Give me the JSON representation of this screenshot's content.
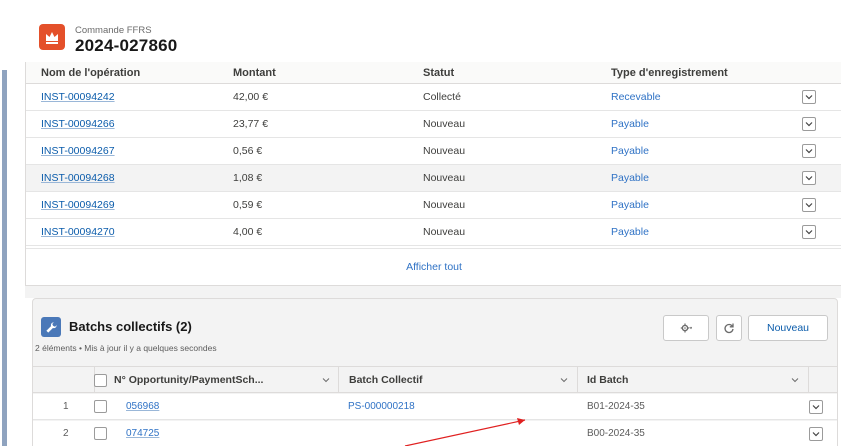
{
  "record": {
    "icon": "crown-icon",
    "object_label": "Commande FFRS",
    "title": "2024-027860"
  },
  "installments": {
    "columns": {
      "name": "Nom de l'opération",
      "amount": "Montant",
      "status": "Statut",
      "record_type": "Type d'enregistrement"
    },
    "rows": [
      {
        "name": "INST-00094242",
        "amount": "42,00 €",
        "status": "Collecté",
        "record_type": "Recevable"
      },
      {
        "name": "INST-00094266",
        "amount": "23,77 €",
        "status": "Nouveau",
        "record_type": "Payable"
      },
      {
        "name": "INST-00094267",
        "amount": "0,56 €",
        "status": "Nouveau",
        "record_type": "Payable"
      },
      {
        "name": "INST-00094268",
        "amount": "1,08 €",
        "status": "Nouveau",
        "record_type": "Payable"
      },
      {
        "name": "INST-00094269",
        "amount": "0,59 €",
        "status": "Nouveau",
        "record_type": "Payable"
      },
      {
        "name": "INST-00094270",
        "amount": "4,00 €",
        "status": "Nouveau",
        "record_type": "Payable"
      }
    ],
    "view_all": "Afficher tout"
  },
  "batches": {
    "icon": "wrench-icon",
    "title": "Batchs collectifs (2)",
    "subtitle": "2 éléments • Mis à jour il y a quelques secondes",
    "buttons": {
      "settings_icon": "gear-icon",
      "refresh_icon": "refresh-icon",
      "new_label": "Nouveau"
    },
    "columns": {
      "opportunity": "N° Opportunity/PaymentSch...",
      "batch": "Batch Collectif",
      "batch_id": "Id Batch"
    },
    "rows": [
      {
        "num": "1",
        "opportunity": "056968",
        "batch": "PS-000000218",
        "batch_id": "B01-2024-35"
      },
      {
        "num": "2",
        "opportunity": "074725",
        "batch": "",
        "batch_id": "B00-2024-35"
      }
    ]
  },
  "colors": {
    "record_icon": "#e4502a",
    "batch_icon": "#4a78b8",
    "link": "#0b5cab",
    "annotation_arrow": "#e02020"
  }
}
